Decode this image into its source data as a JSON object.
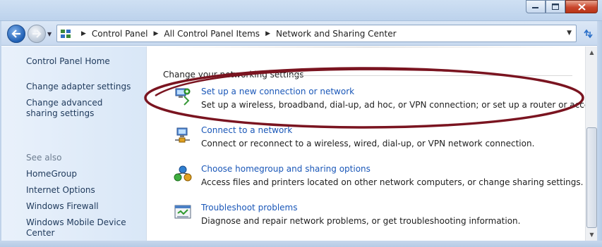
{
  "window": {
    "caption_buttons": [
      "minimize",
      "maximize",
      "close"
    ]
  },
  "navigation": {
    "back_icon": "back-arrow-icon",
    "forward_icon": "forward-arrow-icon",
    "address": {
      "crumbs": [
        "Control Panel",
        "All Control Panel Items",
        "Network and Sharing Center"
      ]
    }
  },
  "sidebar": {
    "home_link": "Control Panel Home",
    "links": [
      "Change adapter settings",
      "Change advanced sharing settings"
    ],
    "see_also_heading": "See also",
    "see_also": [
      "HomeGroup",
      "Internet Options",
      "Windows Firewall",
      "Windows Mobile Device Center"
    ]
  },
  "main": {
    "section_title": "Change your networking settings",
    "tasks": [
      {
        "title": "Set up a new connection or network",
        "description": "Set up a wireless, broadband, dial-up, ad hoc, or VPN connection; or set up a router or access point.",
        "icon": "new-connection-icon"
      },
      {
        "title": "Connect to a network",
        "description": "Connect or reconnect to a wireless, wired, dial-up, or VPN network connection.",
        "icon": "connect-network-icon"
      },
      {
        "title": "Choose homegroup and sharing options",
        "description": "Access files and printers located on other network computers, or change sharing settings.",
        "icon": "homegroup-icon"
      },
      {
        "title": "Troubleshoot problems",
        "description": "Diagnose and repair network problems, or get troubleshooting information.",
        "icon": "troubleshoot-icon"
      }
    ]
  },
  "colors": {
    "link": "#1a57b8",
    "sidebar_bg": "#e4eef9",
    "annotation": "#7a1420"
  }
}
